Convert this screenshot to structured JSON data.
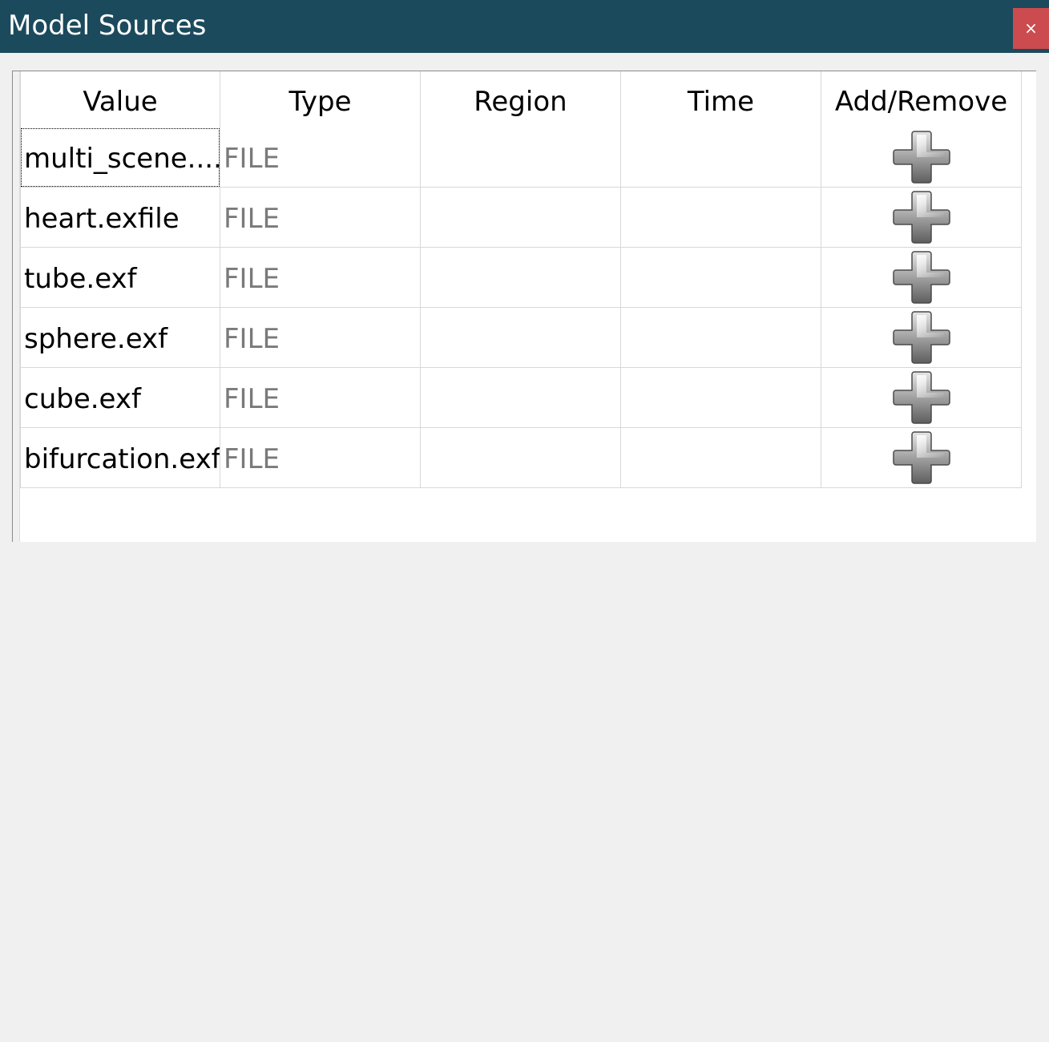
{
  "window": {
    "title": "Model Sources",
    "close_label": "×"
  },
  "table": {
    "columns": [
      "Value",
      "Type",
      "Region",
      "Time",
      "Add/Remove"
    ],
    "rows": [
      {
        "value": "multi_scene....",
        "type": "FILE",
        "region": "",
        "time": "",
        "action_icon": "plus-icon"
      },
      {
        "value": "heart.exfile",
        "type": "FILE",
        "region": "",
        "time": "",
        "action_icon": "plus-icon"
      },
      {
        "value": "tube.exf",
        "type": "FILE",
        "region": "",
        "time": "",
        "action_icon": "plus-icon"
      },
      {
        "value": "sphere.exf",
        "type": "FILE",
        "region": "",
        "time": "",
        "action_icon": "plus-icon"
      },
      {
        "value": "cube.exf",
        "type": "FILE",
        "region": "",
        "time": "",
        "action_icon": "plus-icon"
      },
      {
        "value": "bifurcation.exf",
        "type": "FILE",
        "region": "",
        "time": "",
        "action_icon": "plus-icon"
      }
    ]
  },
  "colors": {
    "titlebar": "#1b4a5c",
    "close_button": "#cc4b4f",
    "type_text": "#7a7a7a"
  }
}
